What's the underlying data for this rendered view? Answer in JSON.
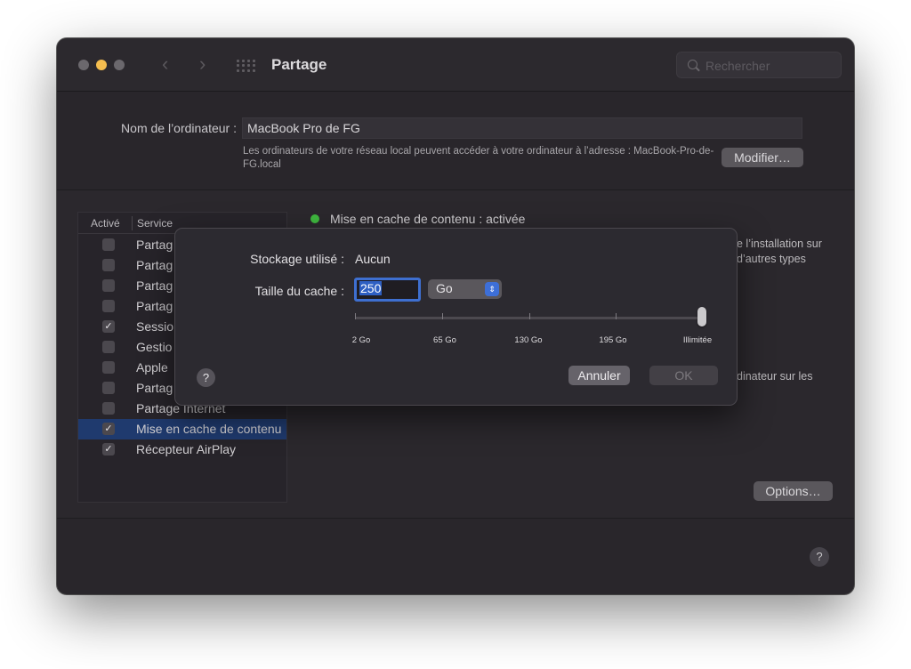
{
  "window": {
    "title": "Partage",
    "search_placeholder": "Rechercher"
  },
  "computer": {
    "name_label": "Nom de l’ordinateur :",
    "name_value": "MacBook Pro de FG",
    "address_text": "Les ordinateurs de votre réseau local peuvent accéder à votre ordinateur à l’adresse : MacBook-Pro-de-FG.local",
    "modify_button": "Modifier…"
  },
  "service_list": {
    "header_active": "Activé",
    "header_service": "Service",
    "items": [
      {
        "label": "Partag",
        "checked": false,
        "selected": false
      },
      {
        "label": "Partag",
        "checked": false,
        "selected": false
      },
      {
        "label": "Partag",
        "checked": false,
        "selected": false
      },
      {
        "label": "Partag",
        "checked": false,
        "selected": false
      },
      {
        "label": "Sessio",
        "checked": true,
        "selected": false
      },
      {
        "label": "Gestio",
        "checked": false,
        "selected": false
      },
      {
        "label": "Apple",
        "checked": false,
        "selected": false
      },
      {
        "label": "Partag",
        "checked": false,
        "selected": false
      },
      {
        "label": "Partage Internet",
        "checked": false,
        "selected": false
      },
      {
        "label": "Mise en cache de contenu",
        "checked": true,
        "selected": true
      },
      {
        "label": "Récepteur AirPlay",
        "checked": true,
        "selected": false
      }
    ]
  },
  "detail": {
    "status_text": "Mise en cache de contenu : activée",
    "status_color": "#3fb83f",
    "fragment_line1": "e l’installation sur",
    "fragment_line2": "d’autres types",
    "fragment_line3": "dinateur sur les",
    "options_button": "Options…"
  },
  "sheet": {
    "storage_label": "Stockage utilisé :",
    "storage_value": "Aucun",
    "cache_label": "Taille du cache :",
    "cache_value": "250",
    "unit_value": "Go",
    "slider_ticks": [
      "2 Go",
      "65 Go",
      "130 Go",
      "195 Go",
      "Illimitée"
    ],
    "slider_position": "Illimitée",
    "cancel_button": "Annuler",
    "ok_button": "OK",
    "help_glyph": "?"
  },
  "footer": {
    "help_glyph": "?"
  },
  "colors": {
    "accent": "#3e6fd0",
    "selection": "#1f3a6e",
    "minimize": "#f4bd4f"
  }
}
